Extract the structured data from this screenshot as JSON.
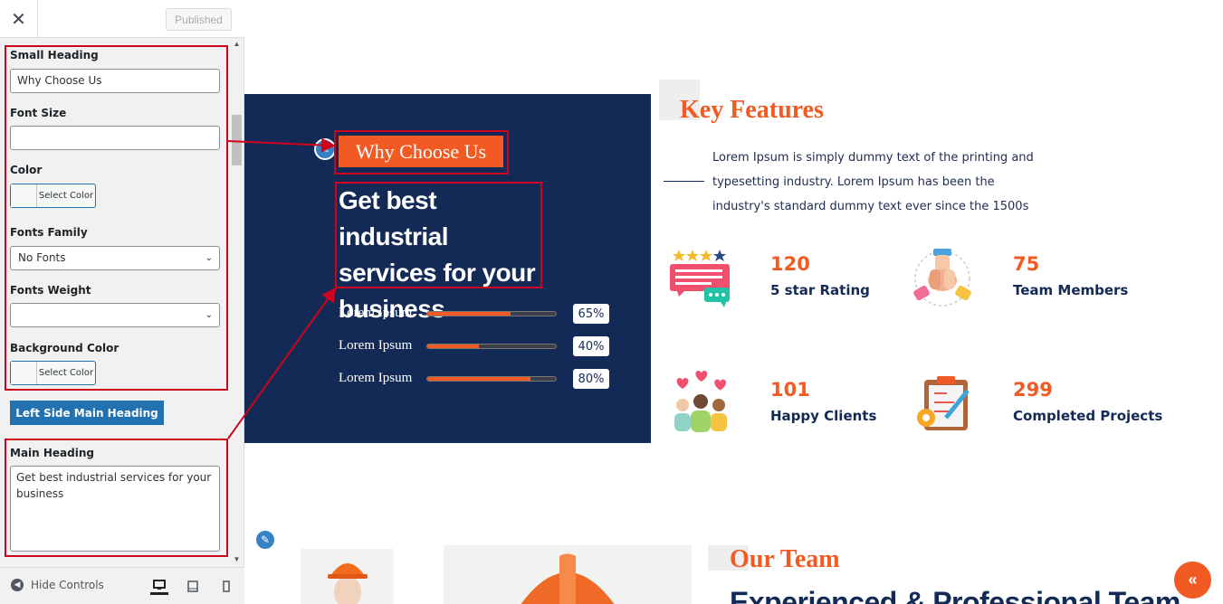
{
  "sidebar": {
    "close_icon": "close-icon",
    "published_label": "Published",
    "fields": {
      "small_heading_label": "Small Heading",
      "small_heading_value": "Why Choose Us",
      "font_size_label": "Font Size",
      "font_size_value": "",
      "color_label": "Color",
      "select_color": "Select Color",
      "fonts_family_label": "Fonts Family",
      "fonts_family_value": "No Fonts",
      "fonts_weight_label": "Fonts Weight",
      "fonts_weight_value": "",
      "background_color_label": "Background Color",
      "section_button": "Left Side Main Heading",
      "main_heading_label": "Main Heading",
      "main_heading_value": "Get best industrial services for your business"
    },
    "footer": {
      "hide_controls": "Hide Controls",
      "devices": [
        "desktop-icon",
        "tablet-icon",
        "mobile-icon"
      ]
    }
  },
  "preview": {
    "small_heading": "Why Choose Us",
    "main_heading": "Get best industrial services for your business",
    "progress": [
      {
        "label": "Lorem Ipsum",
        "value": 65,
        "text": "65%"
      },
      {
        "label": "Lorem Ipsum",
        "value": 40,
        "text": "40%"
      },
      {
        "label": "Lorem Ipsum",
        "value": 80,
        "text": "80%"
      }
    ],
    "key_features": {
      "title": "Key Features",
      "text": "Lorem Ipsum is simply dummy text of the printing and typesetting industry. Lorem Ipsum has been the industry's standard dummy text ever since the 1500s"
    },
    "stats": [
      {
        "num": "120",
        "label": "5 star Rating",
        "icon": "star-rating-icon"
      },
      {
        "num": "75",
        "label": "Team Members",
        "icon": "team-hands-icon"
      },
      {
        "num": "101",
        "label": "Happy Clients",
        "icon": "happy-clients-icon"
      },
      {
        "num": "299",
        "label": "Completed Projects",
        "icon": "clipboard-icon"
      }
    ],
    "team": {
      "title": "Our Team",
      "subtitle": "Experienced & Professional Team"
    },
    "back_to_top_icon": "chevron-double-up-icon"
  },
  "colors": {
    "accent": "#f15a22",
    "navy": "#132a56",
    "wp_blue": "#2271b1",
    "highlight": "#d0021b"
  }
}
